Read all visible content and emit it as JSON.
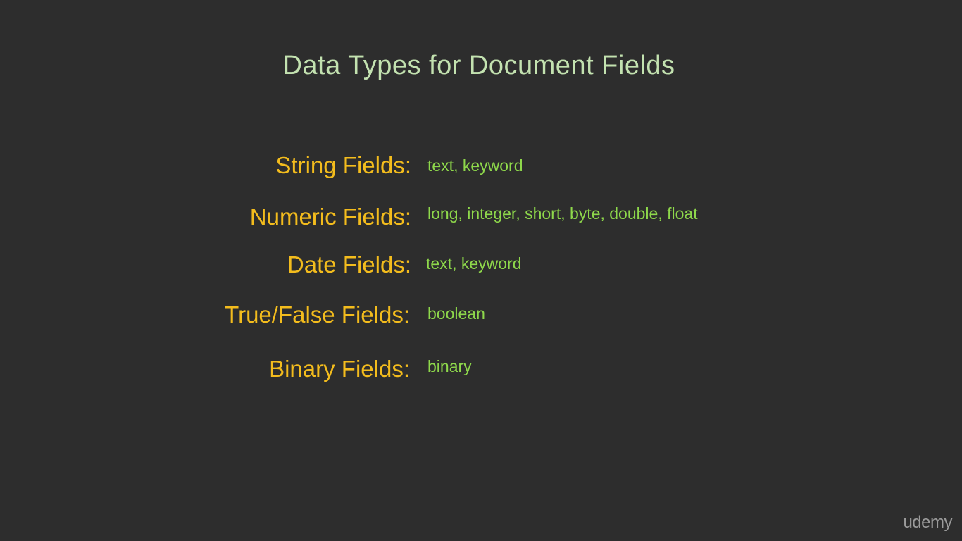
{
  "slide": {
    "title": "Data Types for Document Fields",
    "fields": [
      {
        "label": "String Fields:",
        "types": "text, keyword"
      },
      {
        "label": "Numeric Fields:",
        "types": "long, integer, short, byte, double, float"
      },
      {
        "label": "Date Fields:",
        "types": "text, keyword"
      },
      {
        "label": "True/False Fields:",
        "types": "boolean"
      },
      {
        "label": "Binary Fields:",
        "types": "binary"
      }
    ]
  },
  "watermark": {
    "text": "udemy"
  },
  "colors": {
    "background": "#2d2d2d",
    "title": "#c3e2b0",
    "label": "#f3bc1d",
    "value": "#8ed84b",
    "watermark": "#9b9b9b"
  }
}
